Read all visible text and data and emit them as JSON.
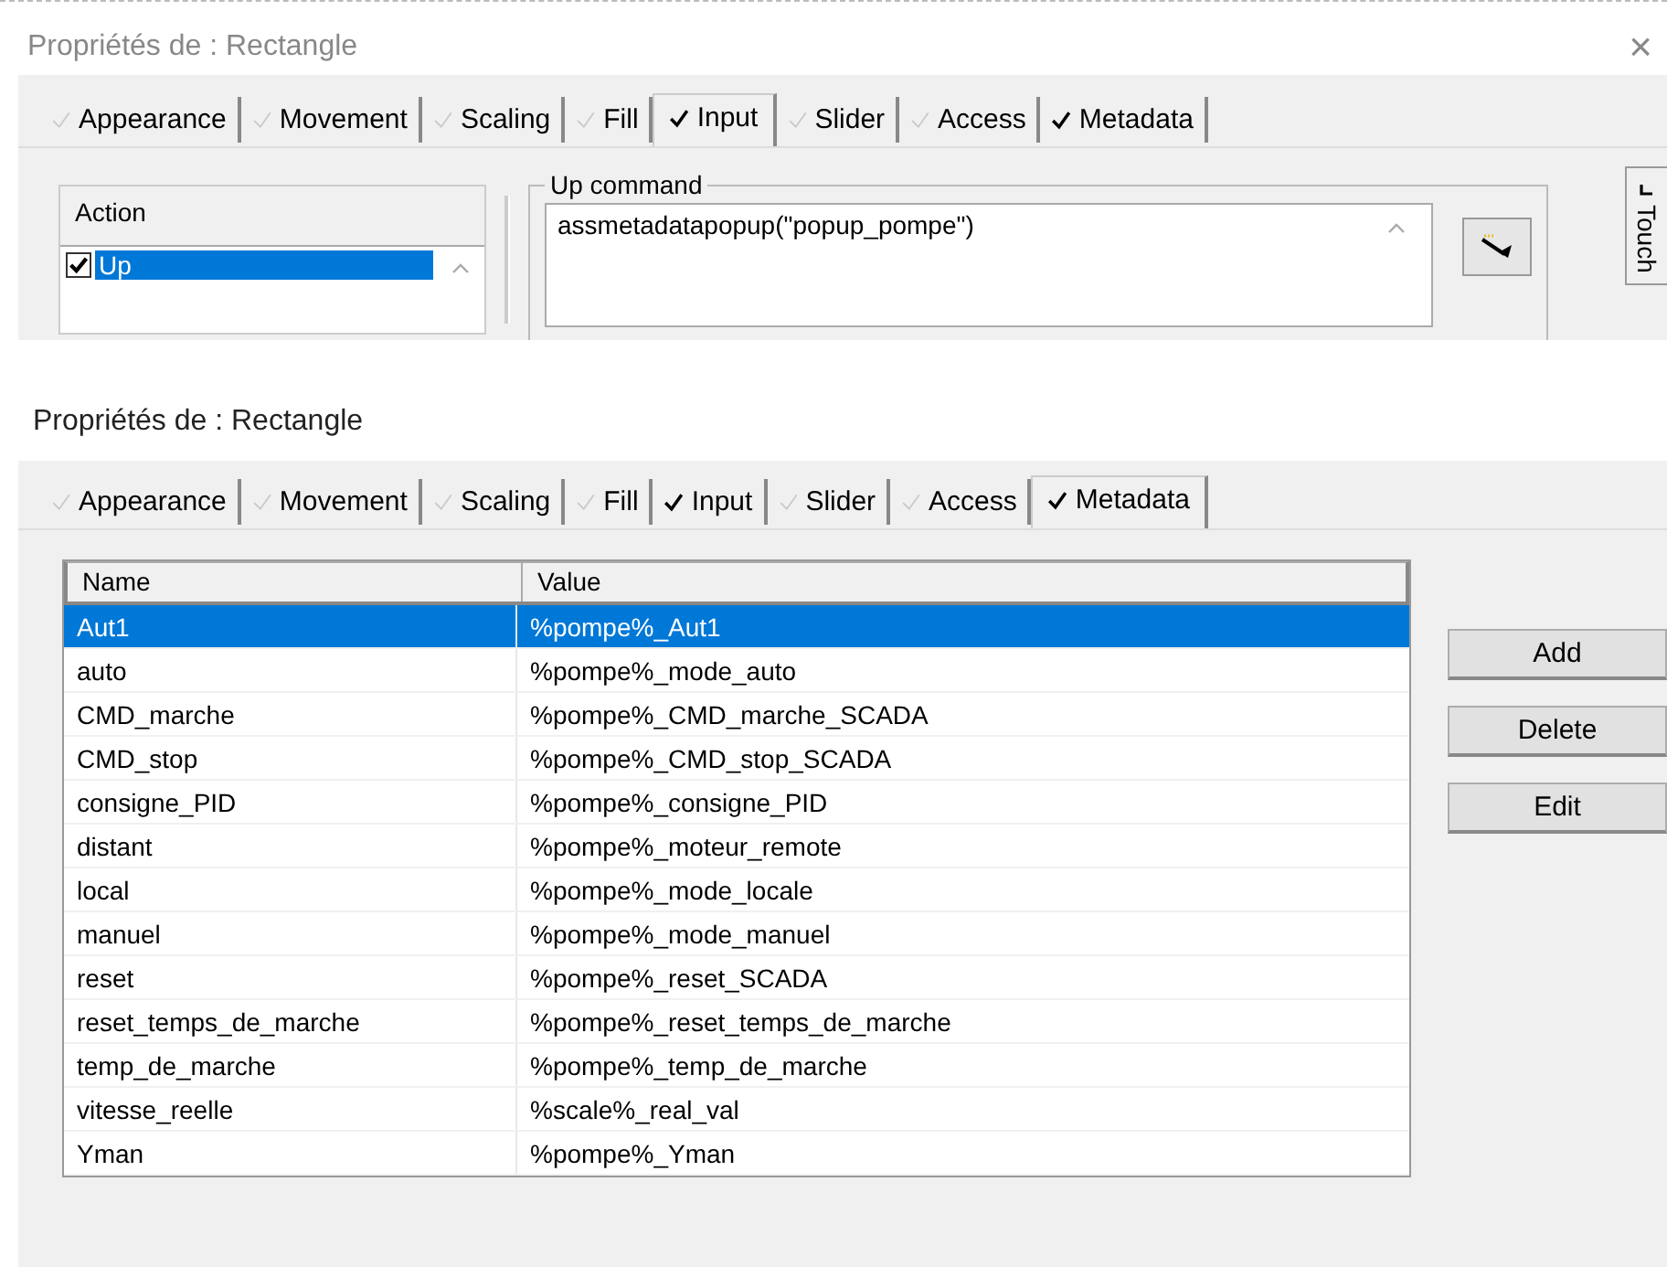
{
  "top_dialog": {
    "title": "Propriétés de : Rectangle",
    "close": "×",
    "tabs": [
      {
        "label": "Appearance",
        "checked": false,
        "selected": false
      },
      {
        "label": "Movement",
        "checked": false,
        "selected": false
      },
      {
        "label": "Scaling",
        "checked": false,
        "selected": false
      },
      {
        "label": "Fill",
        "checked": false,
        "selected": false
      },
      {
        "label": "Input",
        "checked": true,
        "selected": true
      },
      {
        "label": "Slider",
        "checked": false,
        "selected": false
      },
      {
        "label": "Access",
        "checked": false,
        "selected": false
      },
      {
        "label": "Metadata",
        "checked": true,
        "selected": false
      }
    ],
    "action_list": {
      "header": "Action",
      "items": [
        {
          "label": "Up",
          "checked": true,
          "selected": true
        }
      ]
    },
    "up_command": {
      "label": "Up command",
      "value": "assmetadatapopup(\"popup_pompe\")"
    },
    "side_tab": {
      "label": "Touch",
      "checked": true
    }
  },
  "bottom_dialog": {
    "title": "Propriétés de : Rectangle",
    "tabs": [
      {
        "label": "Appearance",
        "checked": false,
        "selected": false
      },
      {
        "label": "Movement",
        "checked": false,
        "selected": false
      },
      {
        "label": "Scaling",
        "checked": false,
        "selected": false
      },
      {
        "label": "Fill",
        "checked": false,
        "selected": false
      },
      {
        "label": "Input",
        "checked": true,
        "selected": false
      },
      {
        "label": "Slider",
        "checked": false,
        "selected": false
      },
      {
        "label": "Access",
        "checked": false,
        "selected": false
      },
      {
        "label": "Metadata",
        "checked": true,
        "selected": true
      }
    ],
    "table": {
      "columns": [
        "Name",
        "Value"
      ],
      "rows": [
        {
          "name": "Aut1",
          "value": "%pompe%_Aut1",
          "selected": true
        },
        {
          "name": "auto",
          "value": "%pompe%_mode_auto",
          "selected": false
        },
        {
          "name": "CMD_marche",
          "value": "%pompe%_CMD_marche_SCADA",
          "selected": false
        },
        {
          "name": "CMD_stop",
          "value": "%pompe%_CMD_stop_SCADA",
          "selected": false
        },
        {
          "name": "consigne_PID",
          "value": "%pompe%_consigne_PID",
          "selected": false
        },
        {
          "name": "distant",
          "value": "%pompe%_moteur_remote",
          "selected": false
        },
        {
          "name": "local",
          "value": "%pompe%_mode_locale",
          "selected": false
        },
        {
          "name": "manuel",
          "value": "%pompe%_mode_manuel",
          "selected": false
        },
        {
          "name": "reset",
          "value": "%pompe%_reset_SCADA",
          "selected": false
        },
        {
          "name": "reset_temps_de_marche",
          "value": "%pompe%_reset_temps_de_marche",
          "selected": false
        },
        {
          "name": "temp_de_marche",
          "value": "%pompe%_temp_de_marche",
          "selected": false
        },
        {
          "name": "vitesse_reelle",
          "value": "%scale%_real_val",
          "selected": false
        },
        {
          "name": "Yman",
          "value": "%pompe%_Yman",
          "selected": false
        }
      ]
    },
    "buttons": [
      "Add",
      "Delete",
      "Edit"
    ]
  }
}
